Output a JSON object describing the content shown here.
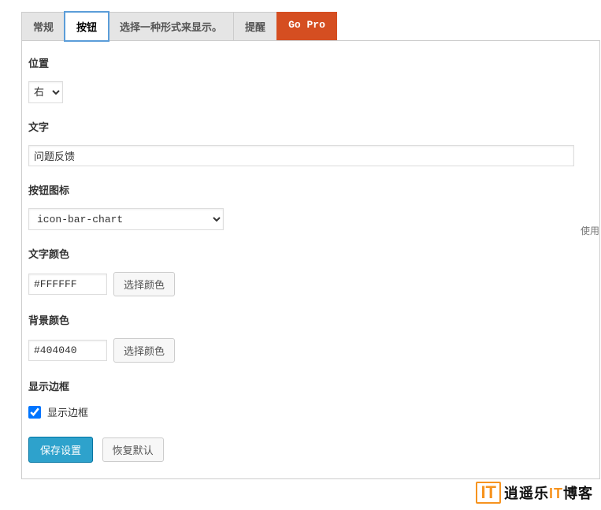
{
  "tabs": {
    "normal": "常规",
    "button": "按钮",
    "display": "选择一种形式来显示。",
    "remind": "提醒",
    "gopro": "Go Pro"
  },
  "fields": {
    "position": {
      "label": "位置",
      "value": "右"
    },
    "text": {
      "label": "文字",
      "value": "问题反馈"
    },
    "icon": {
      "label": "按钮图标",
      "value": "icon-bar-chart"
    },
    "sideHint": "使用",
    "textColor": {
      "label": "文字颜色",
      "value": "#FFFFFF",
      "picker": "选择颜色"
    },
    "bgColor": {
      "label": "背景颜色",
      "value": "#404040",
      "picker": "选择颜色"
    },
    "border": {
      "label": "显示边框",
      "checkbox": "显示边框"
    }
  },
  "actions": {
    "save": "保存设置",
    "reset": "恢复默认"
  },
  "watermark": {
    "logo": "IT",
    "prefix": "逍遥乐",
    "mid": "IT",
    "suffix": "博客"
  }
}
